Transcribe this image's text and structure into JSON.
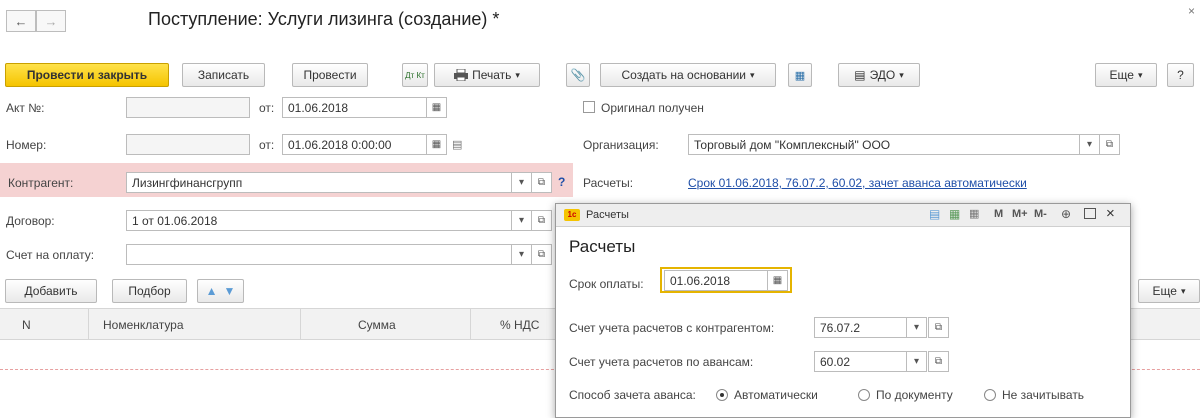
{
  "nav": {
    "back": "←",
    "forward": "→"
  },
  "title": "Поступление: Услуги лизинга (создание) *",
  "toolbar": {
    "post_close": "Провести и закрыть",
    "save": "Записать",
    "post": "Провести",
    "dtkt": "Дт Кт",
    "print": "Печать",
    "create_based": "Создать на основании",
    "edo": "ЭДО",
    "more": "Еще",
    "help": "?"
  },
  "form": {
    "act_label": "Акт №:",
    "act_value": "",
    "from_label": "от:",
    "act_date": "01.06.2018",
    "number_label": "Номер:",
    "number_value": "",
    "number_date": "01.06.2018  0:00:00",
    "original_label": "Оригинал получен",
    "org_label": "Организация:",
    "org_value": "Торговый дом \"Комплексный\" ООО",
    "counterparty_label": "Контрагент:",
    "counterparty_value": "Лизингфинансгрупп",
    "settlements_label": "Расчеты:",
    "settlements_link": "Срок 01.06.2018, 76.07.2, 60.02, зачет аванса автоматически",
    "contract_label": "Договор:",
    "contract_value": "1 от 01.06.2018",
    "invoice_label": "Счет на оплату:",
    "invoice_value": ""
  },
  "table": {
    "add": "Добавить",
    "select": "Подбор",
    "more": "Еще",
    "columns": [
      "N",
      "Номенклатура",
      "Сумма",
      "% НДС"
    ]
  },
  "popup": {
    "window_title": "Расчеты",
    "heading": "Расчеты",
    "due_label": "Срок оплаты:",
    "due_value": "01.06.2018",
    "acc_cp_label": "Счет учета расчетов с контрагентом:",
    "acc_cp_value": "76.07.2",
    "acc_adv_label": "Счет учета расчетов по авансам:",
    "acc_adv_value": "60.02",
    "offset_label": "Способ зачета аванса:",
    "offset_options": [
      "Автоматически",
      "По документу",
      "Не зачитывать"
    ],
    "offset_selected": "Автоматически",
    "titlebar_tools": [
      "M",
      "M+",
      "M-"
    ]
  },
  "colors": {
    "accent": "#f5c400",
    "link": "#1f4fa8",
    "error_bg": "#f5d2d2",
    "highlight_border": "#e5b400"
  }
}
